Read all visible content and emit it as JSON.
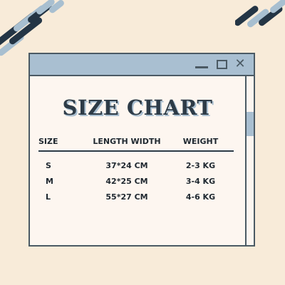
{
  "window": {
    "title": "SIZE CHART",
    "controls": {
      "minimize": "minimize-icon",
      "maximize": "maximize-icon",
      "close": "close-icon"
    }
  },
  "table": {
    "headers": {
      "size": "SIZE",
      "length_width": "LENGTH WIDTH",
      "weight": "WEIGHT"
    },
    "rows": [
      {
        "size": "S",
        "length_width": "37*24 CM",
        "weight": "2-3 KG"
      },
      {
        "size": "M",
        "length_width": "42*25 CM",
        "weight": "3-4 KG"
      },
      {
        "size": "L",
        "length_width": "55*27 CM",
        "weight": "4-6 KG"
      }
    ]
  },
  "colors": {
    "background": "#f8ebd9",
    "dark": "#243545",
    "accent": "#a9bfd1",
    "panel": "#fdf6f0"
  }
}
